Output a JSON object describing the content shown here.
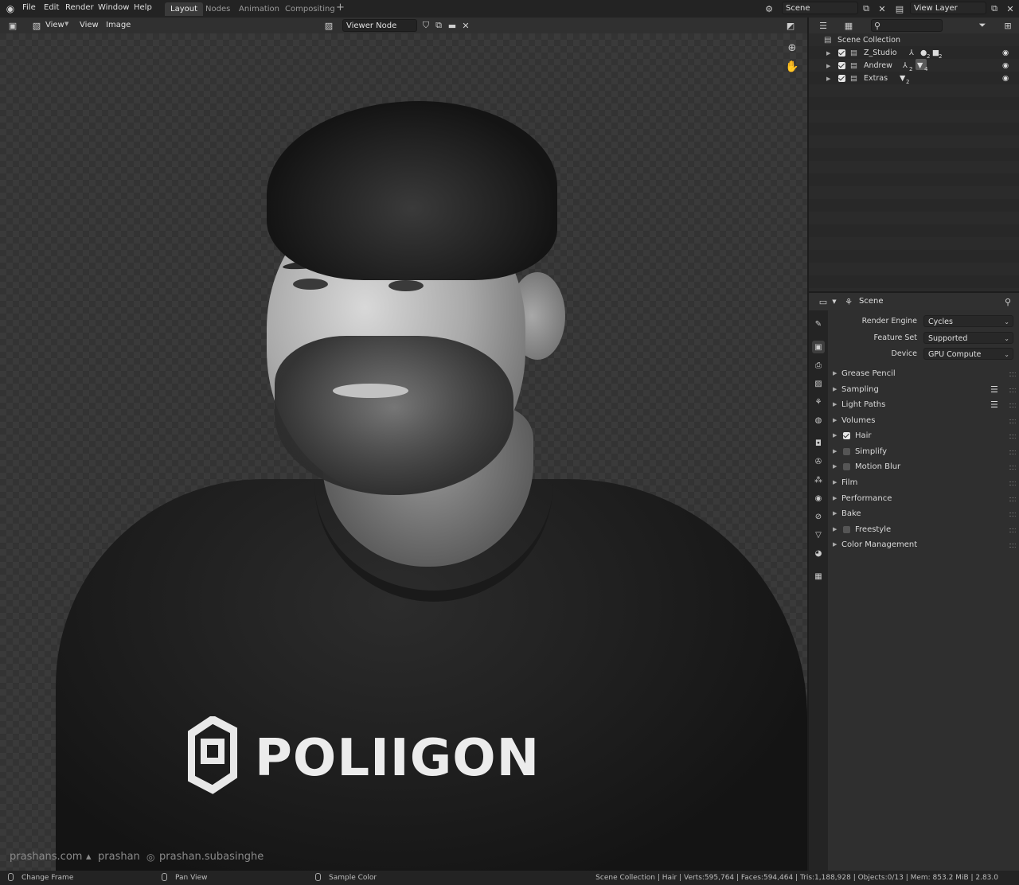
{
  "topbar": {
    "menu": [
      "File",
      "Edit",
      "Render",
      "Window",
      "Help"
    ],
    "workspaces": [
      {
        "label": "Layout",
        "active": true
      },
      {
        "label": "Nodes",
        "active": false
      },
      {
        "label": "Animation",
        "active": false
      },
      {
        "label": "Compositing",
        "active": false
      }
    ],
    "add_tab": "+",
    "scene_name": "Scene",
    "view_layer": "View Layer"
  },
  "image_editor": {
    "view_mode": "View",
    "menus": [
      "View",
      "Image"
    ],
    "image_name": "Viewer Node"
  },
  "viewport": {
    "shirt_logo": "POLIIGON",
    "watermarks": [
      "prashans.com",
      "prashan",
      "prashan.subasinghe"
    ]
  },
  "outliner": {
    "root": "Scene Collection",
    "collections": [
      {
        "name": "Z_Studio",
        "visible": true,
        "badges": [
          "2",
          "2"
        ]
      },
      {
        "name": "Andrew",
        "visible": true,
        "badges": [
          "2",
          "4"
        ]
      },
      {
        "name": "Extras",
        "visible": true,
        "badges": [
          "2"
        ]
      }
    ]
  },
  "properties": {
    "context": "Scene",
    "render_engine": {
      "label": "Render Engine",
      "value": "Cycles"
    },
    "feature_set": {
      "label": "Feature Set",
      "value": "Supported"
    },
    "device": {
      "label": "Device",
      "value": "GPU Compute"
    },
    "panels": [
      {
        "label": "Grease Pencil",
        "checkbox": null,
        "presets": false
      },
      {
        "label": "Sampling",
        "checkbox": null,
        "presets": true
      },
      {
        "label": "Light Paths",
        "checkbox": null,
        "presets": true
      },
      {
        "label": "Volumes",
        "checkbox": null,
        "presets": false
      },
      {
        "label": "Hair",
        "checkbox": true,
        "presets": false
      },
      {
        "label": "Simplify",
        "checkbox": false,
        "presets": false
      },
      {
        "label": "Motion Blur",
        "checkbox": false,
        "presets": false
      },
      {
        "label": "Film",
        "checkbox": null,
        "presets": false
      },
      {
        "label": "Performance",
        "checkbox": null,
        "presets": false
      },
      {
        "label": "Bake",
        "checkbox": null,
        "presets": false
      },
      {
        "label": "Freestyle",
        "checkbox": false,
        "presets": false
      },
      {
        "label": "Color Management",
        "checkbox": null,
        "presets": false
      }
    ]
  },
  "statusbar": {
    "left": "Change Frame",
    "middle": "Pan View",
    "right": "Sample Color",
    "stats": "Scene Collection | Hair | Verts:595,764 | Faces:594,464 | Tris:1,188,928 | Objects:0/13 | Mem: 853.2 MiB | 2.83.0"
  },
  "colors": {
    "panel_bg": "#2f2f2f",
    "header_bg": "#303030",
    "topbar_bg": "#232323",
    "active_tab": "#3a3a3a"
  }
}
